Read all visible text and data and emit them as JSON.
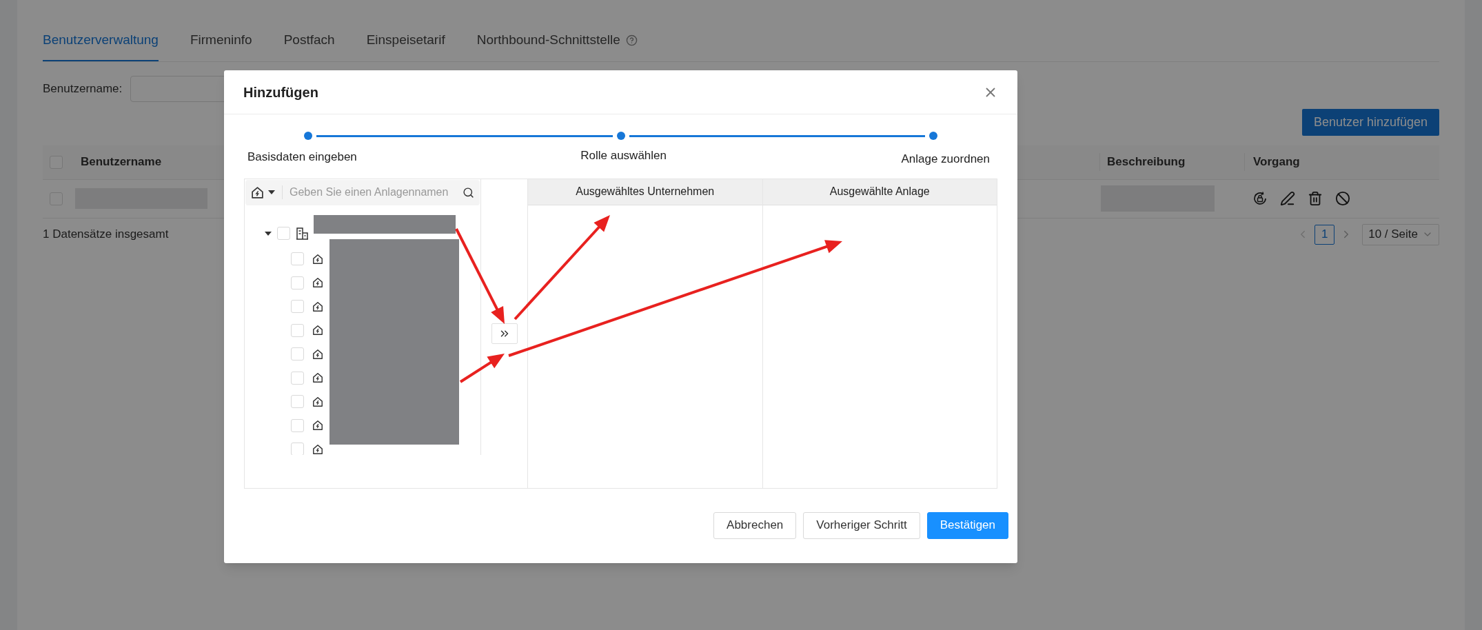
{
  "tabs": [
    {
      "label": "Benutzerverwaltung",
      "selected": true,
      "has_help": false
    },
    {
      "label": "Firmeninfo",
      "selected": false,
      "has_help": false
    },
    {
      "label": "Postfach",
      "selected": false,
      "has_help": false
    },
    {
      "label": "Einspeisetarif",
      "selected": false,
      "has_help": false
    },
    {
      "label": "Northbound-Schnittstelle",
      "selected": false,
      "has_help": true
    }
  ],
  "filter": {
    "label": "Benutzername:"
  },
  "add_button": "Benutzer hinzufügen",
  "table": {
    "select_all_checked": false,
    "columns": [
      "Benutzername",
      "Beschreibung",
      "Vorgang"
    ],
    "rows": [
      {
        "checked": false
      }
    ]
  },
  "summary": "1 Datensätze insgesamt",
  "pagination": {
    "pages": [
      {
        "label": "1",
        "selected": true
      }
    ],
    "page_size": "10 / Seite"
  },
  "dialog": {
    "title": "Hinzufügen",
    "steps": [
      "Basisdaten eingeben",
      "Rolle auswählen",
      "Anlage zuordnen"
    ],
    "tree": {
      "search_placeholder": "Geben Sie einen Anlagennamen",
      "root": {
        "checked": false,
        "expanded": true,
        "children": [
          {
            "checked": false
          },
          {
            "checked": false
          },
          {
            "checked": false
          },
          {
            "checked": false
          },
          {
            "checked": false
          },
          {
            "checked": false
          },
          {
            "checked": false
          },
          {
            "checked": false
          },
          {
            "checked": false
          }
        ]
      }
    },
    "selected_columns": [
      "Ausgewähltes Unternehmen",
      "Ausgewählte Anlage"
    ],
    "buttons": [
      {
        "label": "Abbrechen",
        "kind": "default"
      },
      {
        "label": "Vorheriger Schritt",
        "kind": "default"
      },
      {
        "label": "Bestätigen",
        "kind": "primary"
      }
    ]
  }
}
